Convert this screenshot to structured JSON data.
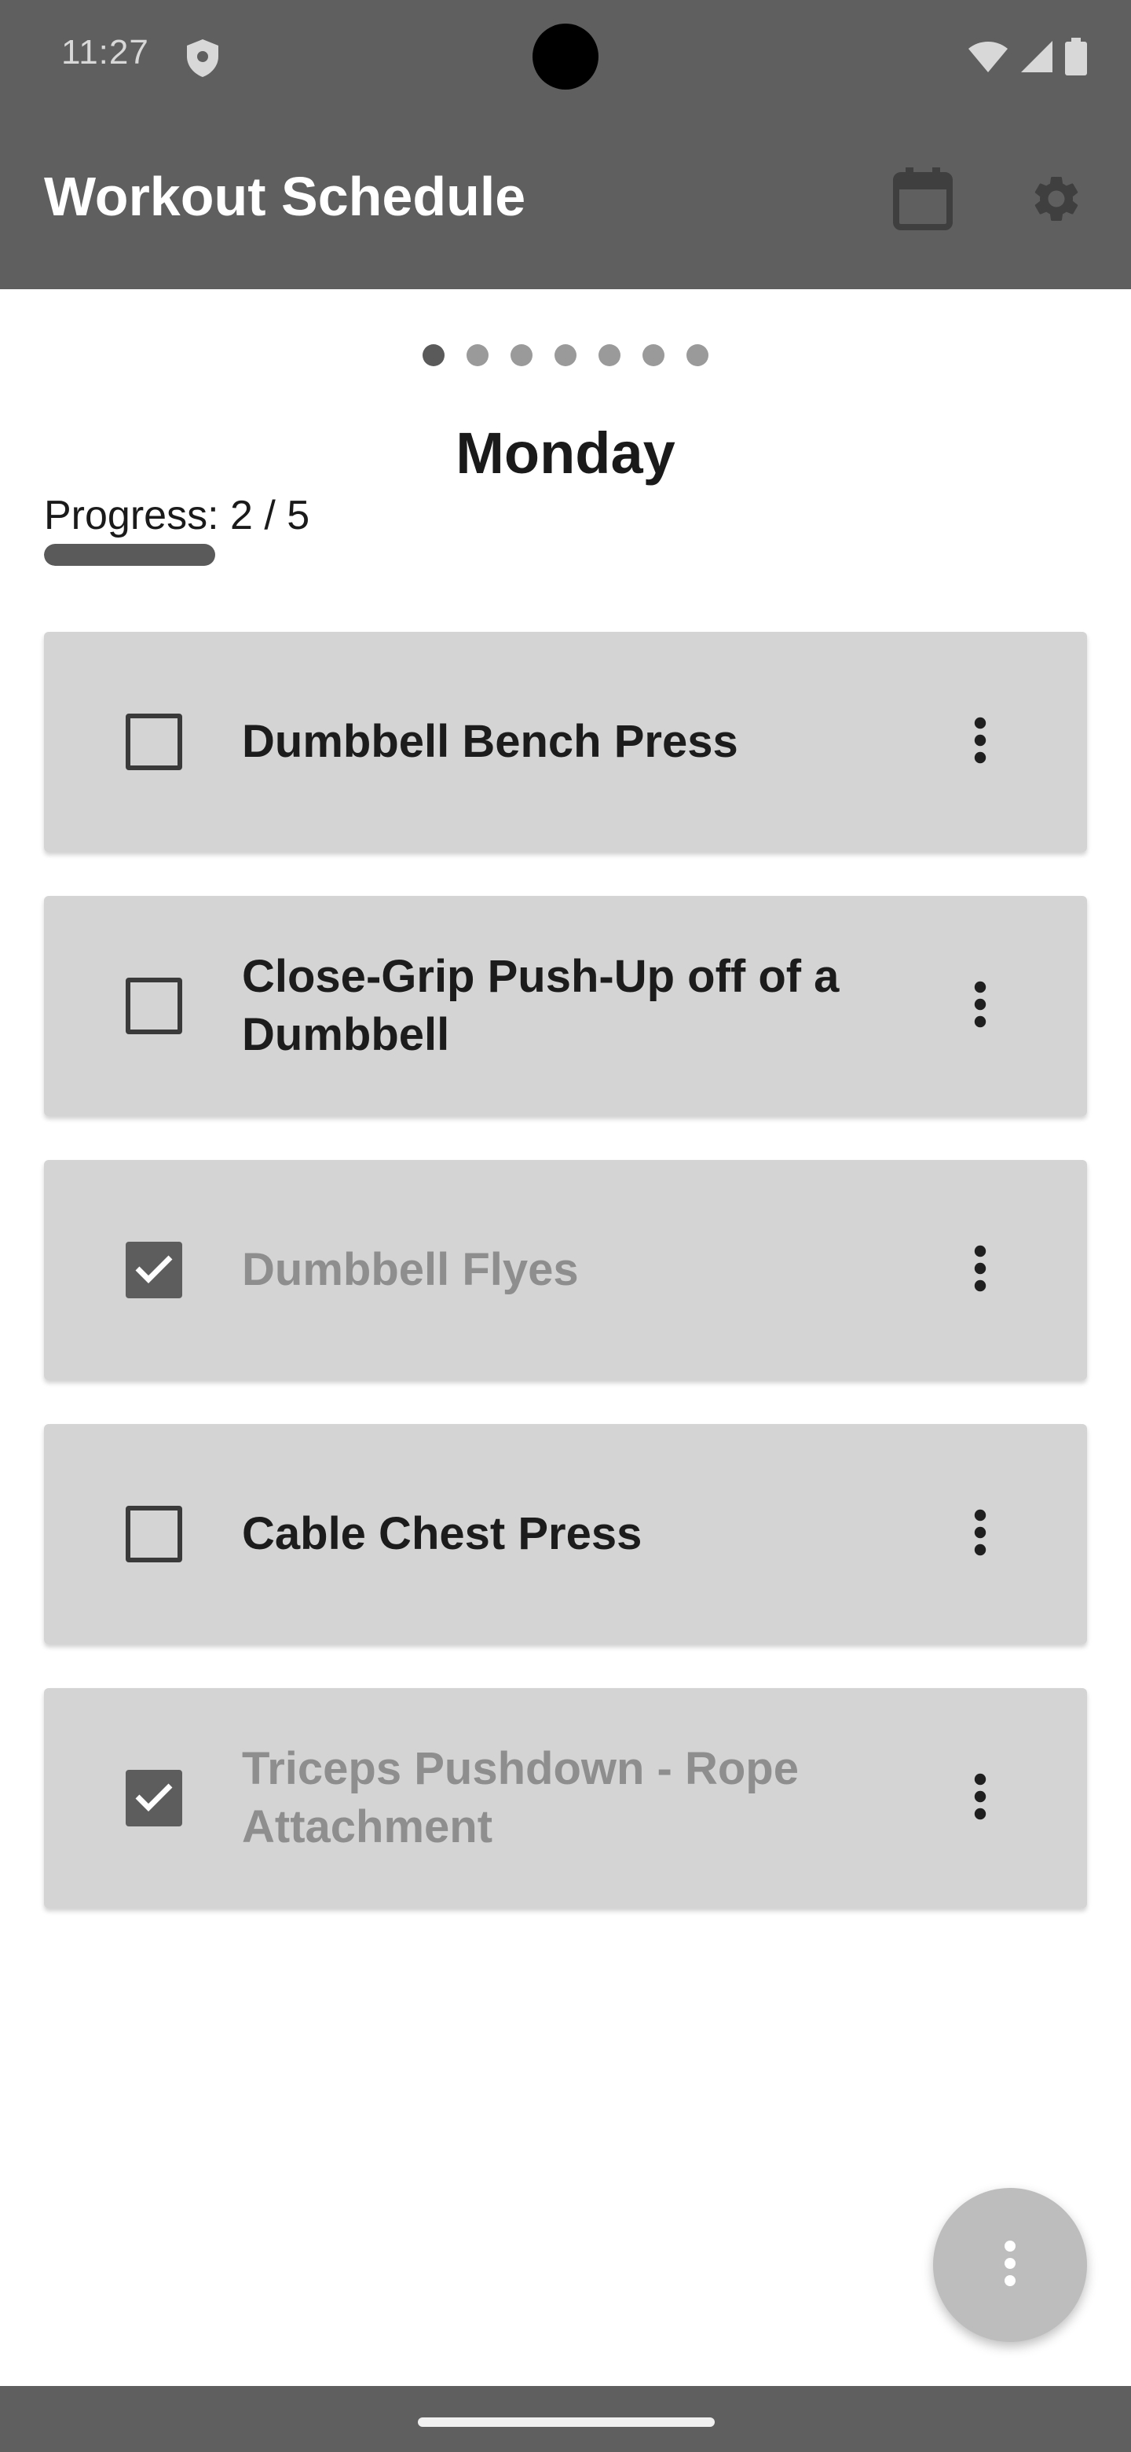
{
  "status_bar": {
    "time": "11:27"
  },
  "app_bar": {
    "title": "Workout Schedule",
    "calendar_icon": "calendar-icon",
    "settings_icon": "gear-icon"
  },
  "pager": {
    "page_count": 7,
    "active_index": 0
  },
  "day": {
    "title": "Monday"
  },
  "progress": {
    "label": "Progress: 2 / 5",
    "completed": 2,
    "total": 5
  },
  "exercises": [
    {
      "name": "Dumbbell Bench Press",
      "checked": false
    },
    {
      "name": "Close-Grip Push-Up off of a Dumbbell",
      "checked": false
    },
    {
      "name": "Dumbbell Flyes",
      "checked": true
    },
    {
      "name": "Cable Chest Press",
      "checked": false
    },
    {
      "name": "Triceps Pushdown - Rope Attachment",
      "checked": true
    }
  ],
  "fab": {
    "icon": "more-vertical-icon"
  },
  "colors": {
    "bar_background": "#5f5f5f",
    "card_background": "#d4d4d4",
    "checked_fill": "#5d5d5d",
    "done_text": "#8e8e8e",
    "fab_background": "#bdbdbd"
  }
}
